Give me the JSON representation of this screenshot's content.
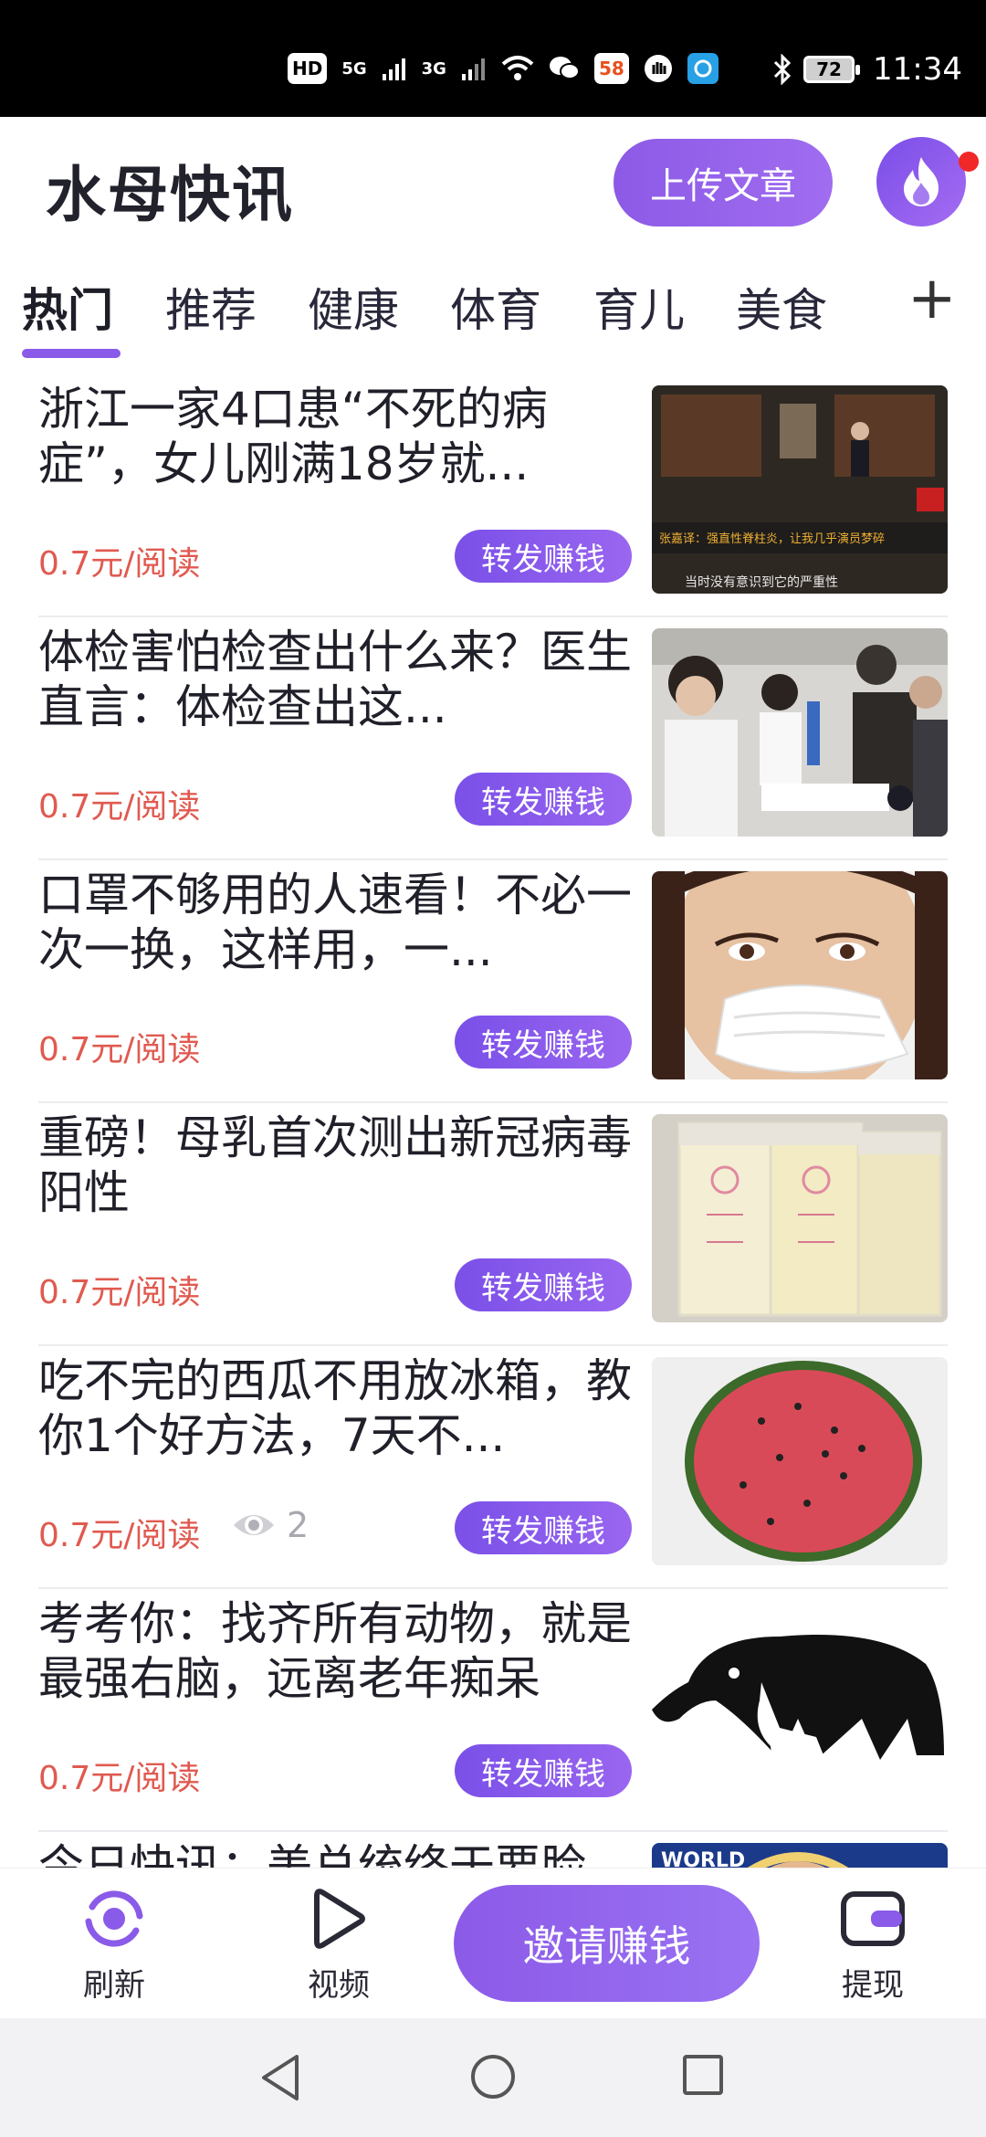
{
  "status_bar": {
    "hd_label": "HD",
    "net1": "5G",
    "net2": "3G",
    "app58": "58",
    "battery": "72",
    "time": "11:34"
  },
  "header": {
    "title": "水母快讯",
    "upload_label": "上传文章"
  },
  "tabs": [
    {
      "label": "热门"
    },
    {
      "label": "推荐"
    },
    {
      "label": "健康"
    },
    {
      "label": "体育"
    },
    {
      "label": "育儿"
    },
    {
      "label": "美食"
    }
  ],
  "tab_add": "+",
  "articles": [
    {
      "title": "浙江一家4口患“不死的病症”，女儿刚满18岁就...",
      "price": "0.7元/阅读",
      "share": "转发赚钱",
      "thumb_caption": "张嘉译：强直性脊柱炎，让我几乎演员梦碎",
      "thumb_caption2": "当时没有意识到它的严重性"
    },
    {
      "title": "体检害怕检查出什么来？医生直言：体检查出这...",
      "price": "0.7元/阅读",
      "share": "转发赚钱"
    },
    {
      "title": "口罩不够用的人速看！不必一次一换，这样用，一...",
      "price": "0.7元/阅读",
      "share": "转发赚钱"
    },
    {
      "title": "重磅！母乳首次测出新冠病毒阳性",
      "price": "0.7元/阅读",
      "share": "转发赚钱"
    },
    {
      "title": "吃不完的西瓜不用放冰箱，教你1个好方法，7天不...",
      "price": "0.7元/阅读",
      "share": "转发赚钱",
      "views": "2"
    },
    {
      "title": "考考你：找齐所有动物，就是最强右脑，远离老年痴呆",
      "price": "0.7元/阅读",
      "share": "转发赚钱"
    },
    {
      "title": "今日快讯：美总统终于要脸",
      "thumb_caption": "WORLD"
    }
  ],
  "bottom_nav": {
    "refresh": "刷新",
    "video": "视频",
    "invite": "邀请赚钱",
    "withdraw": "提现"
  },
  "colors": {
    "accent": "#8a5ae8",
    "price": "#e05a50"
  }
}
